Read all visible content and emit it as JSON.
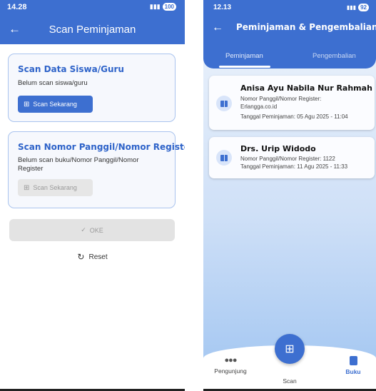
{
  "left_screen": {
    "status": {
      "time": "14.28",
      "battery": "100"
    },
    "appbar": {
      "title": "Scan Peminjaman"
    },
    "card_member": {
      "title": "Scan Data Siswa/Guru",
      "description": "Belum scan siswa/guru",
      "button_label": "Scan Sekarang"
    },
    "card_book": {
      "title": "Scan Nomor Panggil/Nomor Register",
      "description": "Belum scan buku/Nomor Panggil/Nomor Register",
      "button_label": "Scan Sekarang"
    },
    "oke_label": "OKE",
    "reset_label": "Reset"
  },
  "right_screen": {
    "status": {
      "time": "12.13",
      "battery": "92"
    },
    "appbar": {
      "title": "Peminjaman & Pengembalian"
    },
    "tabs": [
      {
        "label": "Peminjaman",
        "active": true
      },
      {
        "label": "Pengembalian",
        "active": false
      }
    ],
    "loans": [
      {
        "name": "Anisa Ayu Nabila Nur Rahmah",
        "call_number_line1": "Nomor Panggil/Nomor Register:",
        "call_number_line2": "Erlangga.co.id",
        "loan_date": "Tanggal Peminjaman: 05 Agu 2025 - 11:04"
      },
      {
        "name": "Drs. Urip Widodo",
        "call_number_line1": "Nomor Panggil/Nomor Register: 1122",
        "loan_date": "Tanggal Peminjaman: 11 Agu 2025 - 11:33"
      }
    ],
    "bottom_nav": [
      {
        "label": "Pengunjung",
        "icon": "people-icon"
      },
      {
        "label": "Scan",
        "icon": "qr-scan-icon"
      },
      {
        "label": "Buku",
        "icon": "book-icon",
        "active": true
      }
    ]
  },
  "colors": {
    "primary": "#3d6fd0",
    "card_border": "#a9c3ee",
    "disabled": "#e3e3e3"
  }
}
